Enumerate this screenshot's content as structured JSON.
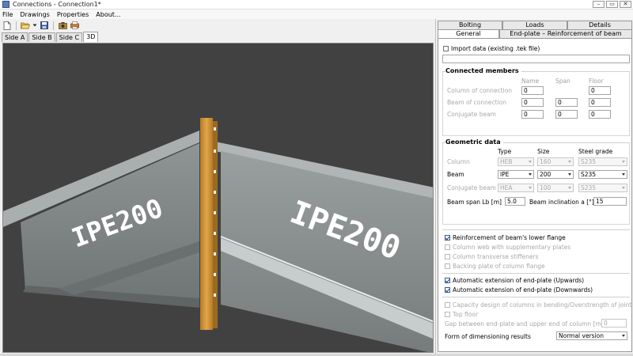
{
  "window": {
    "title": "Connections - Connection1*",
    "min_symbol": "–",
    "max_symbol": "▭",
    "close_symbol": "✕"
  },
  "menu": [
    "File",
    "Drawings",
    "Properties",
    "About..."
  ],
  "toolbar": {
    "icons": [
      "new-file-icon",
      "open-folder-icon",
      "dropdown-arrow-icon",
      "save-icon",
      "camera-icon",
      "print-icon"
    ]
  },
  "view_tabs": [
    {
      "label": "Side A",
      "active": false
    },
    {
      "label": "Side B",
      "active": false
    },
    {
      "label": "Side C",
      "active": false
    },
    {
      "label": "3D",
      "active": true
    }
  ],
  "viewport": {
    "left_beam_label": "IPE200",
    "right_beam_label": "IPE200",
    "colors": {
      "background": "#414141",
      "steel": "#8a8f8f",
      "plate": "#d79a3c"
    }
  },
  "panel": {
    "tabs_row1": [
      "Bolting",
      "Loads",
      "Details"
    ],
    "tabs_row2": [
      "General",
      "End-plate – Reinforcement of beam"
    ],
    "import_label": "Import data (existing .tek file)",
    "import_path": "",
    "connected": {
      "title": "Connected members",
      "headers": [
        "Name",
        "Span",
        "Floor"
      ],
      "rows": [
        {
          "label": "Column of connection",
          "name": "0",
          "floor": "0"
        },
        {
          "label": "Beam of connection",
          "name": "0",
          "span": "0",
          "floor": "0"
        },
        {
          "label": "Conjugate beam",
          "name": "0",
          "span": "0",
          "floor": "0"
        }
      ]
    },
    "geometric": {
      "title": "Geometric data",
      "headers": [
        "Type",
        "Size",
        "Steel grade"
      ],
      "rows": [
        {
          "label": "Column",
          "type": "HEB",
          "size": "160",
          "grade": "S235"
        },
        {
          "label": "Beam",
          "type": "IPE",
          "size": "200",
          "grade": "S235"
        },
        {
          "label": "Conjugate beam",
          "type": "HEA",
          "size": "100",
          "grade": "S235"
        }
      ],
      "span_label": "Beam span Lb [m]",
      "span_value": "5.0",
      "incl_label": "Beam inclination a [°]",
      "incl_value": "15"
    },
    "options1": [
      {
        "label": "Reinforcement of beam's lower flange",
        "checked": true,
        "enabled": true
      },
      {
        "label": "Column web with supplementary plates",
        "checked": false,
        "enabled": false
      },
      {
        "label": "Column transverse stiffeners",
        "checked": false,
        "enabled": false
      },
      {
        "label": "Backing plate of column flange",
        "checked": false,
        "enabled": false
      }
    ],
    "options2": [
      {
        "label": "Automatic extension of end-plate (Upwards)",
        "checked": true,
        "enabled": true
      },
      {
        "label": "Automatic extension of end-plate (Downwards)",
        "checked": true,
        "enabled": true
      }
    ],
    "options3": [
      {
        "label": "Capacity design of columns in bending/Overstrength of joint",
        "checked": false,
        "enabled": false
      },
      {
        "label": "Top floor",
        "checked": false,
        "enabled": false
      }
    ],
    "gap_label": "Gap between end-plate and upper end of column [mm]",
    "gap_value": "0",
    "form_label": "Form of dimensioning results",
    "form_value": "Normal version"
  }
}
